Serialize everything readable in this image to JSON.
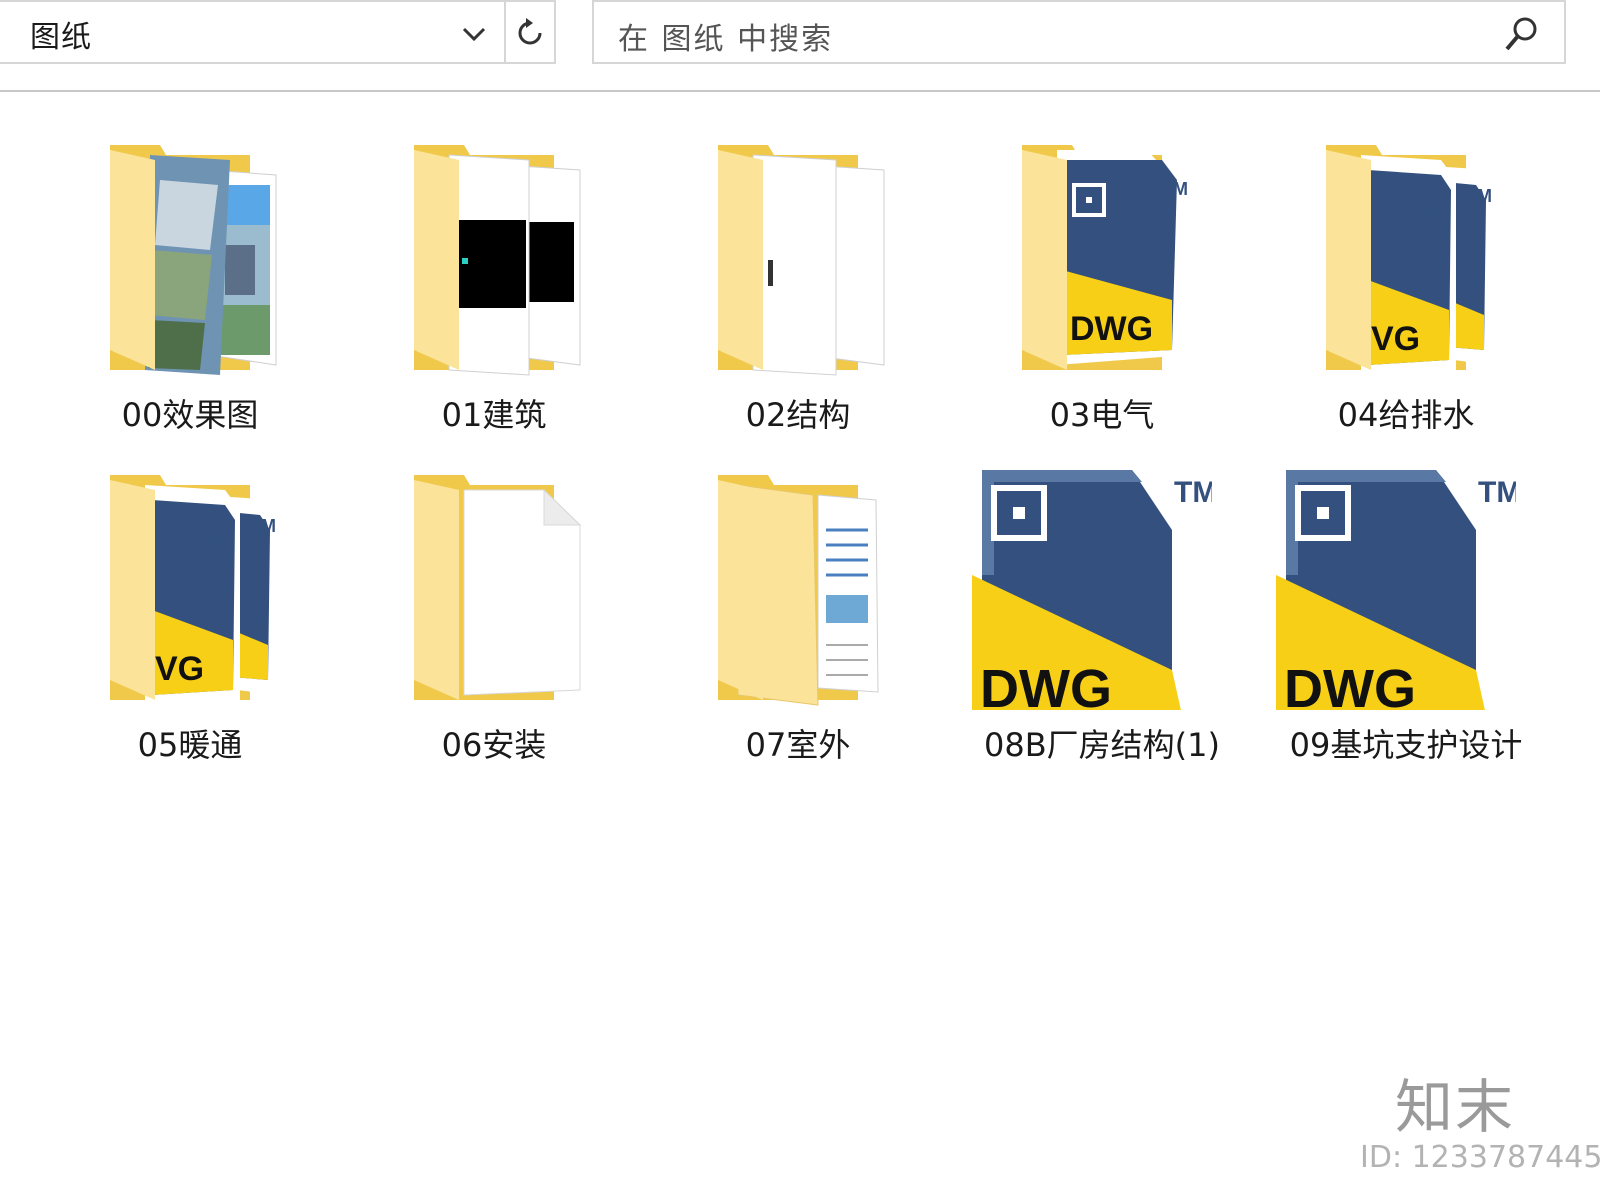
{
  "address_bar": {
    "path": "图纸",
    "dropdown_icon": "chevron-down-icon",
    "refresh_icon": "refresh-icon"
  },
  "search": {
    "placeholder": "在 图纸 中搜索",
    "icon": "search-icon"
  },
  "items": [
    {
      "name": "00效果图",
      "thumbnail": "folder-photo"
    },
    {
      "name": "01建筑",
      "thumbnail": "folder-drawings"
    },
    {
      "name": "02结构",
      "thumbnail": "folder-blank-pages"
    },
    {
      "name": "03电气",
      "thumbnail": "folder-dwg"
    },
    {
      "name": "04给排水",
      "thumbnail": "folder-dwg-double"
    },
    {
      "name": "05暖通",
      "thumbnail": "folder-dwg-double"
    },
    {
      "name": "06安装",
      "thumbnail": "folder-document"
    },
    {
      "name": "07室外",
      "thumbnail": "folder-documents"
    },
    {
      "name": "08B厂房结构(1)",
      "thumbnail": "dwg-file"
    },
    {
      "name": "09基坑支护设计",
      "thumbnail": "dwg-file"
    }
  ],
  "watermark": {
    "brand": "知末",
    "id": "ID: 1233787445"
  },
  "colors": {
    "folder_back": "#f0c94a",
    "folder_front": "#fbe39a",
    "dwg_navy": "#33507e",
    "dwg_yellow": "#f6cf16"
  }
}
